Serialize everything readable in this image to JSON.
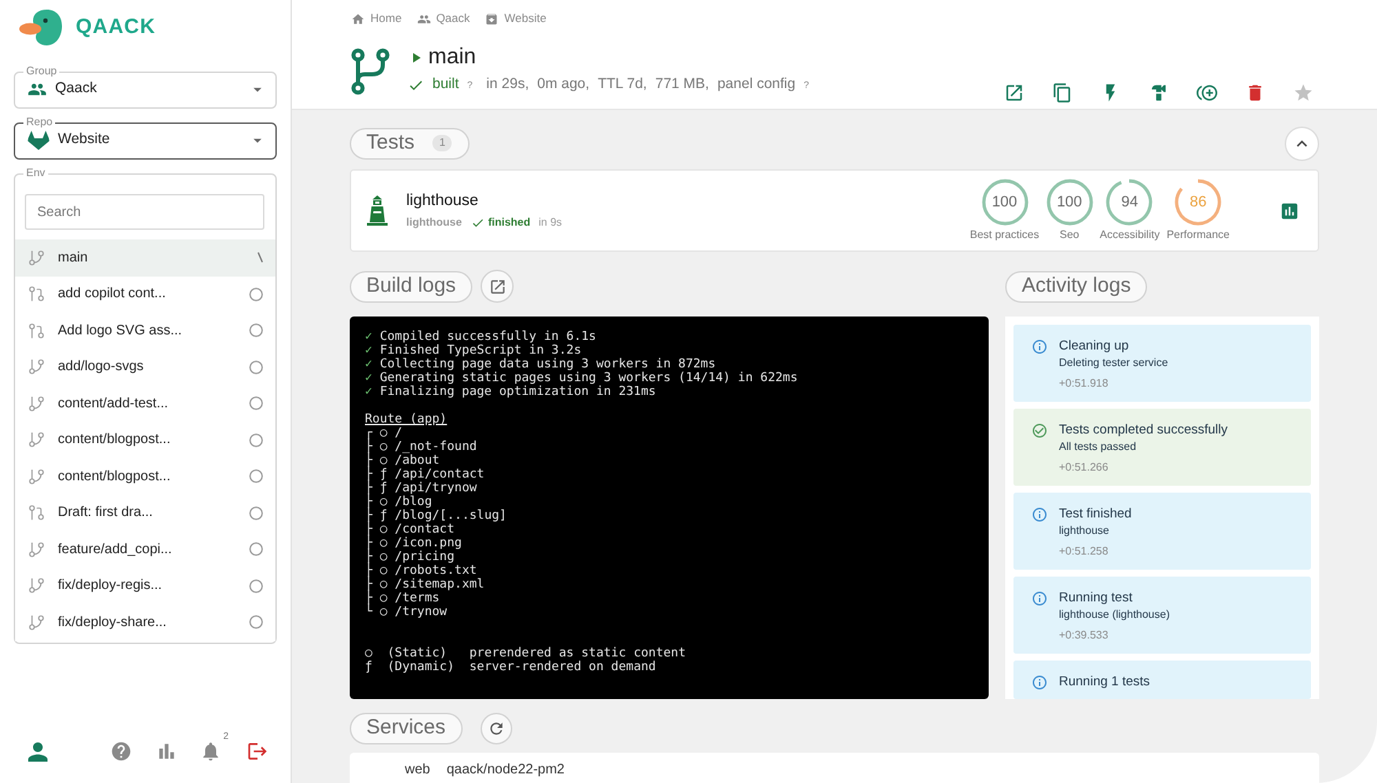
{
  "sidebar": {
    "brand": "QAACK",
    "group": {
      "legend": "Group",
      "value": "Qaack",
      "focused": false
    },
    "repo": {
      "legend": "Repo",
      "value": "Website",
      "focused": true
    },
    "env": {
      "legend": "Env",
      "search": {
        "placeholder": "Search"
      },
      "items": [
        {
          "label": "main",
          "kind": "branch",
          "selected": true,
          "running": true
        },
        {
          "label": "add copilot cont...",
          "kind": "merge-request",
          "selected": false,
          "running": false
        },
        {
          "label": "Add logo SVG ass...",
          "kind": "merge-request",
          "selected": false,
          "running": false
        },
        {
          "label": "add/logo-svgs",
          "kind": "branch",
          "selected": false,
          "running": false
        },
        {
          "label": "content/add-test...",
          "kind": "branch",
          "selected": false,
          "running": false
        },
        {
          "label": "content/blogpost...",
          "kind": "branch",
          "selected": false,
          "running": false
        },
        {
          "label": "content/blogpost...",
          "kind": "branch",
          "selected": false,
          "running": false
        },
        {
          "label": "Draft: first dra...",
          "kind": "merge-request",
          "selected": false,
          "running": false
        },
        {
          "label": "feature/add_copi...",
          "kind": "branch",
          "selected": false,
          "running": false
        },
        {
          "label": "fix/deploy-regis...",
          "kind": "branch",
          "selected": false,
          "running": false
        },
        {
          "label": "fix/deploy-share...",
          "kind": "branch",
          "selected": false,
          "running": false
        }
      ]
    },
    "notifications": "2"
  },
  "header": {
    "breadcrumbs": [
      {
        "kind": "home",
        "label": "Home"
      },
      {
        "kind": "group",
        "label": "Qaack"
      },
      {
        "kind": "repo",
        "label": "Website"
      }
    ],
    "title": "main",
    "status": {
      "label": "built",
      "kind": "success",
      "hint": "?"
    },
    "details": [
      {
        "text": "in 29s,"
      },
      {
        "text": "0m ago,"
      },
      {
        "text": "TTL 7d,"
      },
      {
        "text": "771 MB,"
      },
      {
        "text": "panel config",
        "hint": "?"
      }
    ],
    "starred": false
  },
  "tests": {
    "title": "Tests",
    "count": "1",
    "expanded": true,
    "items": [
      {
        "name": "lighthouse",
        "type": "lighthouse",
        "status": {
          "label": "finished",
          "kind": "success"
        },
        "duration": "in 9s",
        "scores": [
          {
            "value": "100",
            "label": "Best practices",
            "level": 1
          },
          {
            "value": "100",
            "label": "Seo",
            "level": 1
          },
          {
            "value": "94",
            "label": "Accessibility",
            "level": 0.94
          },
          {
            "value": "86",
            "label": "Performance",
            "level": 0.86
          }
        ]
      }
    ]
  },
  "build_logs": {
    "title": "Build logs",
    "blocks": [
      {
        "kind": "steps",
        "lines": [
          {
            "mark": "✓",
            "text": "Compiled successfully in 6.1s"
          },
          {
            "mark": "✓",
            "text": "Finished TypeScript in 3.2s"
          },
          {
            "mark": "✓",
            "text": "Collecting page data using 3 workers in 872ms"
          },
          {
            "mark": "✓",
            "text": "Generating static pages using 3 workers (14/14) in 622ms"
          },
          {
            "mark": "✓",
            "text": "Finalizing page optimization in 231ms"
          }
        ]
      },
      {
        "kind": "routes",
        "heading": "Route (app)",
        "lines": [
          "┌ ○ /",
          "├ ○ /_not-found",
          "├ ○ /about",
          "├ ƒ /api/contact",
          "├ ƒ /api/trynow",
          "├ ○ /blog",
          "├ ƒ /blog/[...slug]",
          "├ ○ /contact",
          "├ ○ /icon.png",
          "├ ○ /pricing",
          "├ ○ /robots.txt",
          "├ ○ /sitemap.xml",
          "├ ○ /terms",
          "└ ○ /trynow"
        ]
      },
      {
        "kind": "legend",
        "lines": [
          "○  (Static)   prerendered as static content",
          "ƒ  (Dynamic)  server-rendered on demand"
        ]
      }
    ]
  },
  "activity": {
    "title": "Activity logs",
    "items": [
      {
        "kind": "info",
        "title": "Cleaning up",
        "detail": "Deleting tester service",
        "time": "+0:51.918"
      },
      {
        "kind": "success",
        "title": "Tests completed successfully",
        "detail": "All tests passed",
        "time": "+0:51.266"
      },
      {
        "kind": "info",
        "title": "Test finished",
        "detail": "lighthouse",
        "time": "+0:51.258"
      },
      {
        "kind": "info",
        "title": "Running test",
        "detail": "lighthouse (lighthouse)",
        "time": "+0:39.533"
      },
      {
        "kind": "info",
        "title": "Running 1 tests"
      }
    ]
  },
  "services": {
    "title": "Services",
    "items": [
      {
        "name": "web",
        "image": "qaack/node22-pm2"
      }
    ]
  }
}
